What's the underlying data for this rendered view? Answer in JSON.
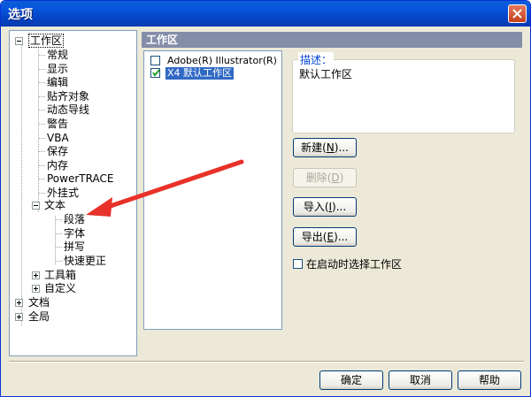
{
  "window": {
    "title": "选项"
  },
  "tree": {
    "root_workspace": "工作区",
    "workspace_children": [
      "常规",
      "显示",
      "编辑",
      "贴齐对象",
      "动态导线",
      "警告",
      "VBA",
      "保存",
      "内存",
      "PowerTRACE",
      "外挂式"
    ],
    "text_node": "文本",
    "text_children": [
      "段落",
      "字体",
      "拼写",
      "快速更正"
    ],
    "toolbox": "工具箱",
    "customize": "自定义",
    "document": "文档",
    "global": "全局"
  },
  "panel": {
    "header": "工作区",
    "workspaces": [
      {
        "label": "Adobe(R) Illustrator(R)",
        "checked": false
      },
      {
        "label": "X4 默认工作区",
        "checked": true
      }
    ],
    "description_label": "描述：",
    "description_text": "默认工作区",
    "new_button": {
      "pre": "新建(",
      "key": "N",
      "post": ")..."
    },
    "delete_button": {
      "pre": "删除(",
      "key": "D",
      "post": ")"
    },
    "import_button": {
      "pre": "导入(",
      "key": "I",
      "post": ")..."
    },
    "export_button": {
      "pre": "导出(",
      "key": "E",
      "post": ")..."
    },
    "startup_checkbox_label": "在启动时选择工作区"
  },
  "footer": {
    "ok": "确定",
    "cancel": "取消",
    "help": "帮助"
  },
  "colors": {
    "titlebar": "#0855dd",
    "panel_header": "#848ea8",
    "selection": "#316ac5",
    "annotation_arrow": "#e8312a"
  }
}
